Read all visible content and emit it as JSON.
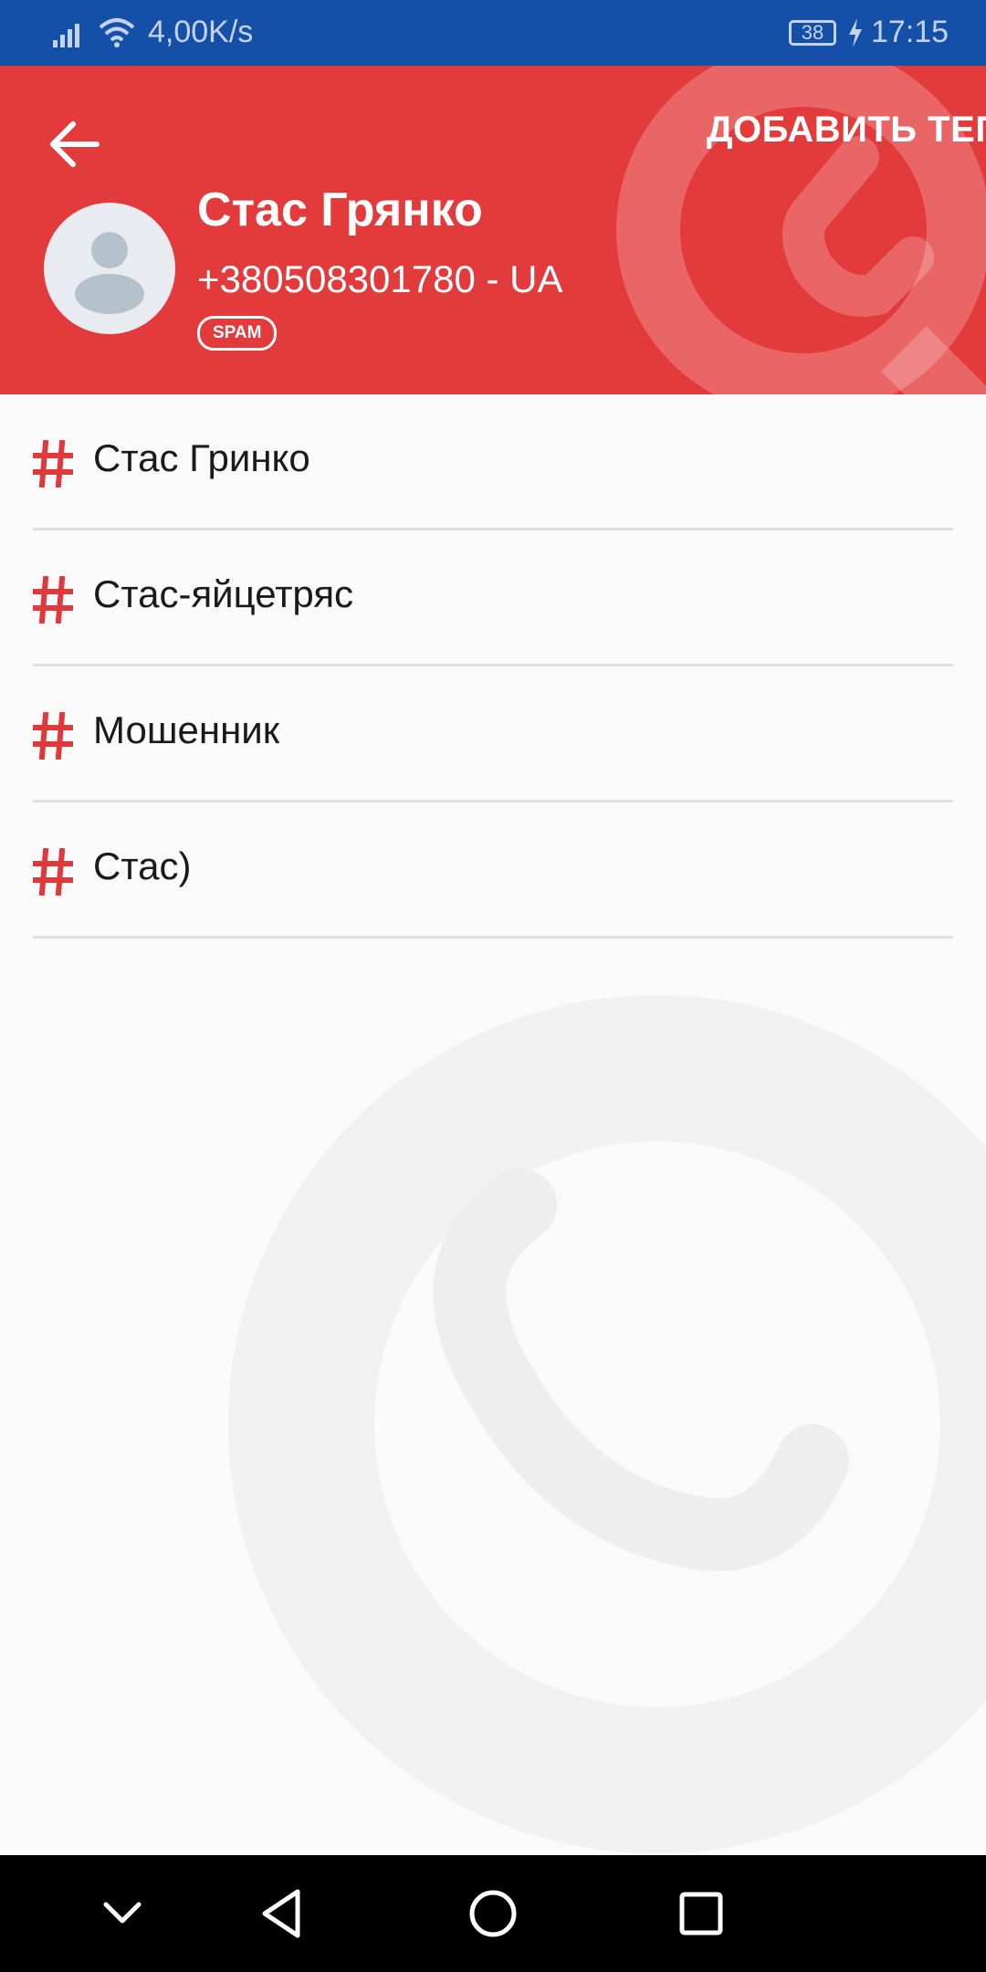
{
  "status_bar": {
    "net_speed": "4,00K/s",
    "battery": "38",
    "time": "17:15"
  },
  "header": {
    "add_tag_label": "ДОБАВИТЬ ТЕГ",
    "contact_name": "Стас Грянко",
    "phone": "+380508301780 - UA",
    "badge": "SPAM",
    "accent_color": "#e33a3c"
  },
  "tags": [
    {
      "label": "Стас Гринко"
    },
    {
      "label": "Стас-яйцетряс"
    },
    {
      "label": "Мошенник"
    },
    {
      "label": "Стас)"
    }
  ],
  "nav": {
    "buttons": [
      "collapse-icon",
      "back-icon",
      "home-icon",
      "recents-icon"
    ]
  }
}
